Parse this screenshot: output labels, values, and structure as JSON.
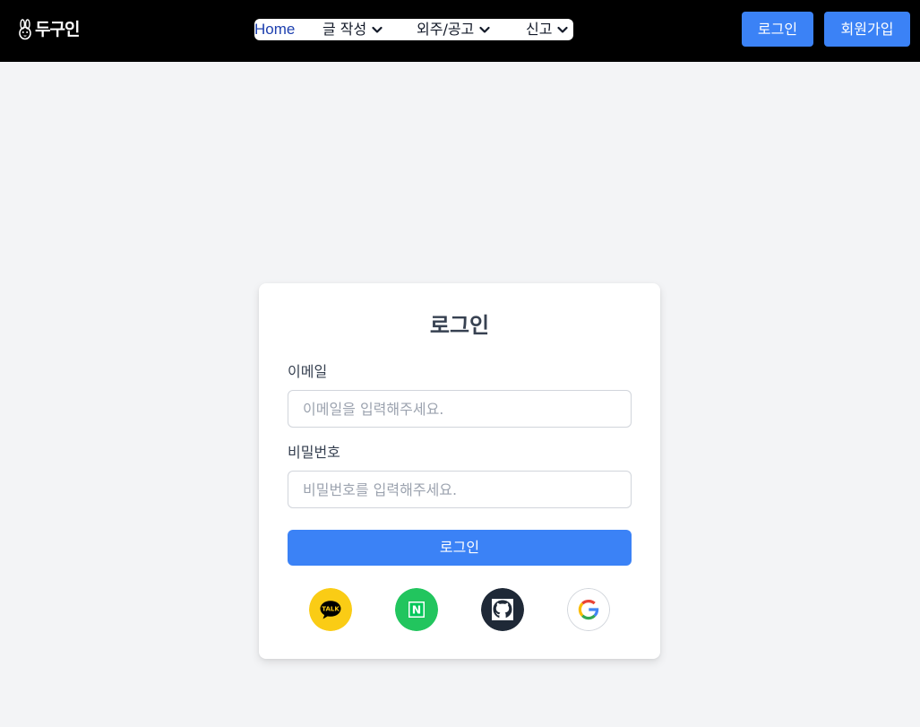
{
  "header": {
    "logo_text": "두구인",
    "nav": [
      {
        "label": "Home"
      },
      {
        "label": "글 작성"
      },
      {
        "label": "외주/공고"
      },
      {
        "label": "신고"
      }
    ],
    "login_label": "로그인",
    "signup_label": "회원가입"
  },
  "login_form": {
    "title": "로그인",
    "email_label": "이메일",
    "email_placeholder": "이메일을 입력해주세요.",
    "email_value": "",
    "password_label": "비밀번호",
    "password_placeholder": "비밀번호를 입력해주세요.",
    "password_value": "",
    "submit_label": "로그인"
  },
  "social_logins": [
    {
      "provider": "kakao",
      "icon": "kakao-talk-icon",
      "icon_text": "TALK",
      "color": "#FEE500"
    },
    {
      "provider": "naver",
      "icon": "naver-icon",
      "icon_text": "N",
      "color": "#03C75A"
    },
    {
      "provider": "github",
      "icon": "github-icon",
      "color": "#1F2937"
    },
    {
      "provider": "google",
      "icon": "google-icon",
      "color": "#FFFFFF"
    }
  ],
  "colors": {
    "header_bg": "#000000",
    "page_bg": "#F3F4F6",
    "accent": "#3B82F6",
    "nav_active": "#1E40AF"
  }
}
